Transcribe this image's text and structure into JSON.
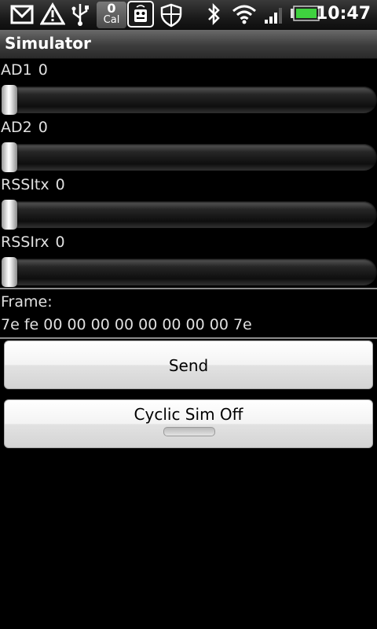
{
  "status_bar": {
    "icons": [
      "gmail-icon",
      "warning-icon",
      "usb-icon",
      "calendar-counter-icon",
      "remote-control-icon",
      "shield-icon",
      "bluetooth-icon",
      "wifi-icon",
      "signal-icon",
      "battery-icon"
    ],
    "cal_count": "0",
    "cal_label": "Cal",
    "time": "10:47"
  },
  "title": "Simulator",
  "sliders": [
    {
      "label": "AD1",
      "value": "0",
      "level": 0
    },
    {
      "label": "AD2",
      "value": "0",
      "level": 0
    },
    {
      "label": "RSSItx",
      "value": "0",
      "level": 0
    },
    {
      "label": "RSSIrx",
      "value": "0",
      "level": 0
    }
  ],
  "frame": {
    "label": "Frame:",
    "value": "7e fe 00 00 00 00 00 00 00 00 7e"
  },
  "buttons": {
    "send": "Send",
    "cyclic": "Cyclic Sim Off"
  },
  "colors": {
    "background": "#000000",
    "battery_fill": "#3fd23f"
  }
}
